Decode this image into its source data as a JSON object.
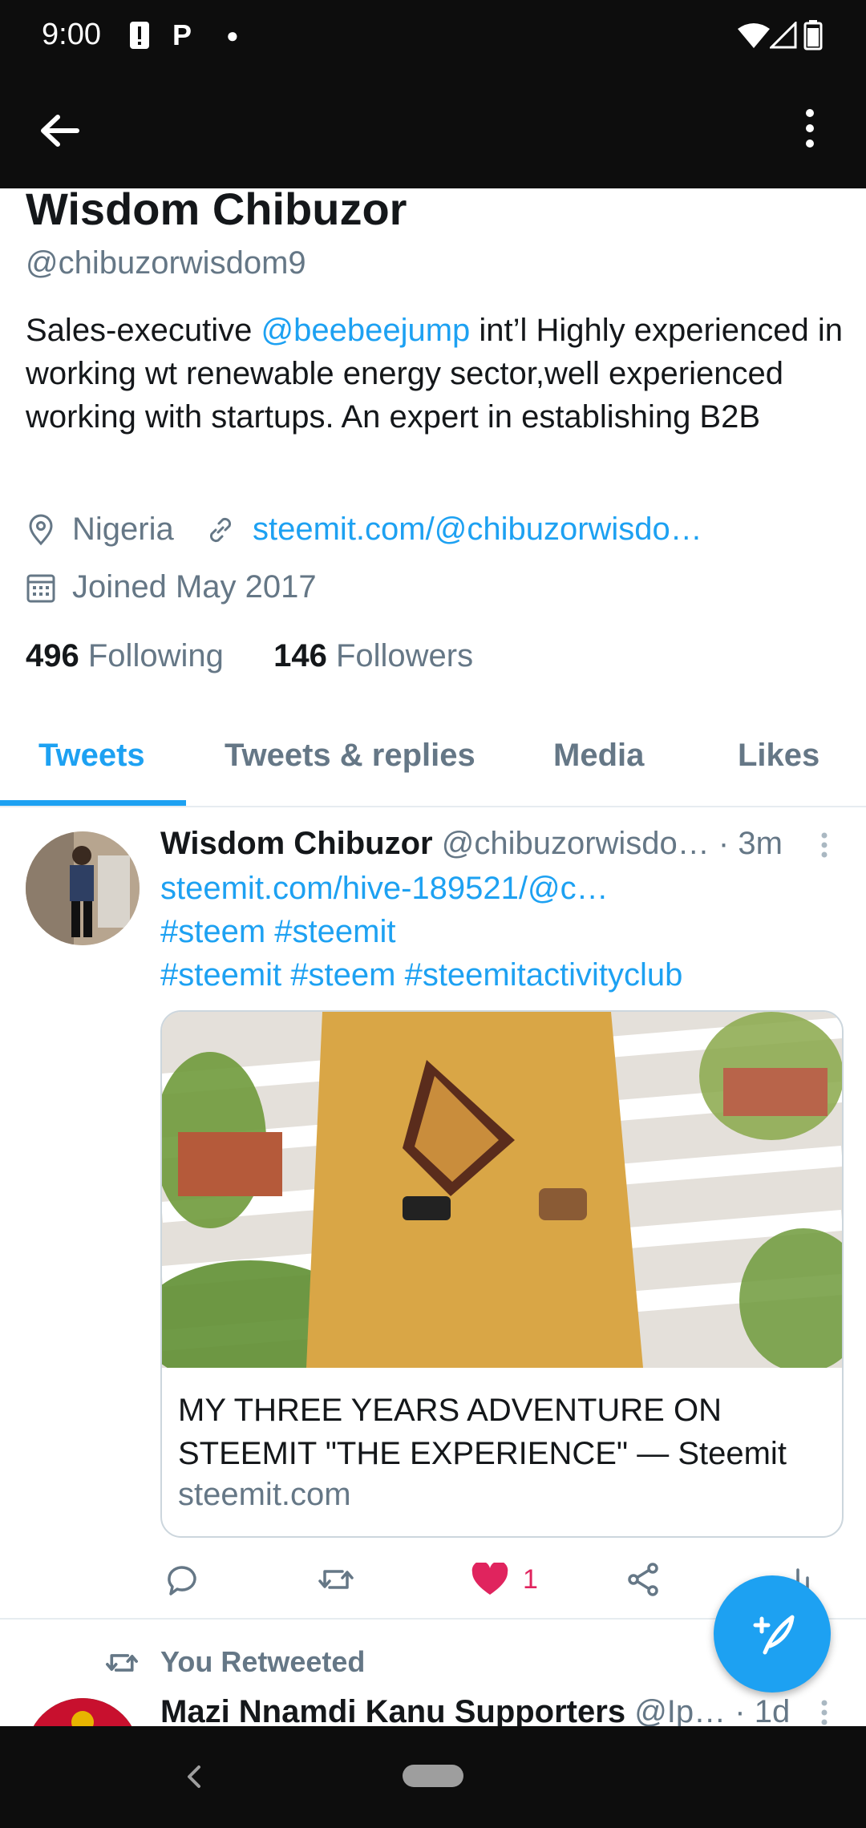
{
  "status": {
    "time": "9:00",
    "notif_1": "!",
    "notif_2": "P"
  },
  "profile": {
    "name": "Wisdom Chibuzor",
    "handle": "@chibuzorwisdom9",
    "bio_before": "Sales-executive ",
    "bio_mention": "@beebeejump",
    "bio_after": " int’l Highly experienced in working wt renewable energy sector,well experienced working with startups. An expert in establishing B2B",
    "location": "Nigeria",
    "website": "steemit.com/@chibuzorwisdo…",
    "joined": "Joined May 2017",
    "following_count": "496",
    "following_label": "Following",
    "followers_count": "146",
    "followers_label": "Followers"
  },
  "tabs": [
    {
      "label": "Tweets"
    },
    {
      "label": "Tweets & replies"
    },
    {
      "label": "Media"
    },
    {
      "label": "Likes"
    }
  ],
  "tweet": {
    "author": "Wisdom Chibuzor",
    "handle": "@chibuzorwisdo…",
    "time": "· 3m",
    "line1": "steemit.com/hive-189521/@c…",
    "line2": "#steem #steemit",
    "line3": "#steemit #steem #steemitactivityclub",
    "card_title": "MY THREE YEARS ADVENTURE ON STEEMIT \"THE EXPERIENCE\" — Steemit",
    "card_domain": "steemit.com",
    "like_count": "1"
  },
  "retweet": {
    "label": "You Retweeted",
    "author": "Mazi Nnamdi Kanu Supporters",
    "handle": "@Ip…",
    "time": "· 1d"
  },
  "colors": {
    "accent": "#1da1f2",
    "like": "#e0245e",
    "muted": "#657786",
    "bar": "#0d0d0d"
  },
  "icons": [
    "arrow-left-icon",
    "more-vertical-icon",
    "location-pin-icon",
    "link-icon",
    "calendar-icon",
    "reply-icon",
    "retweet-icon",
    "heart-icon",
    "share-icon",
    "analytics-icon",
    "compose-icon"
  ]
}
